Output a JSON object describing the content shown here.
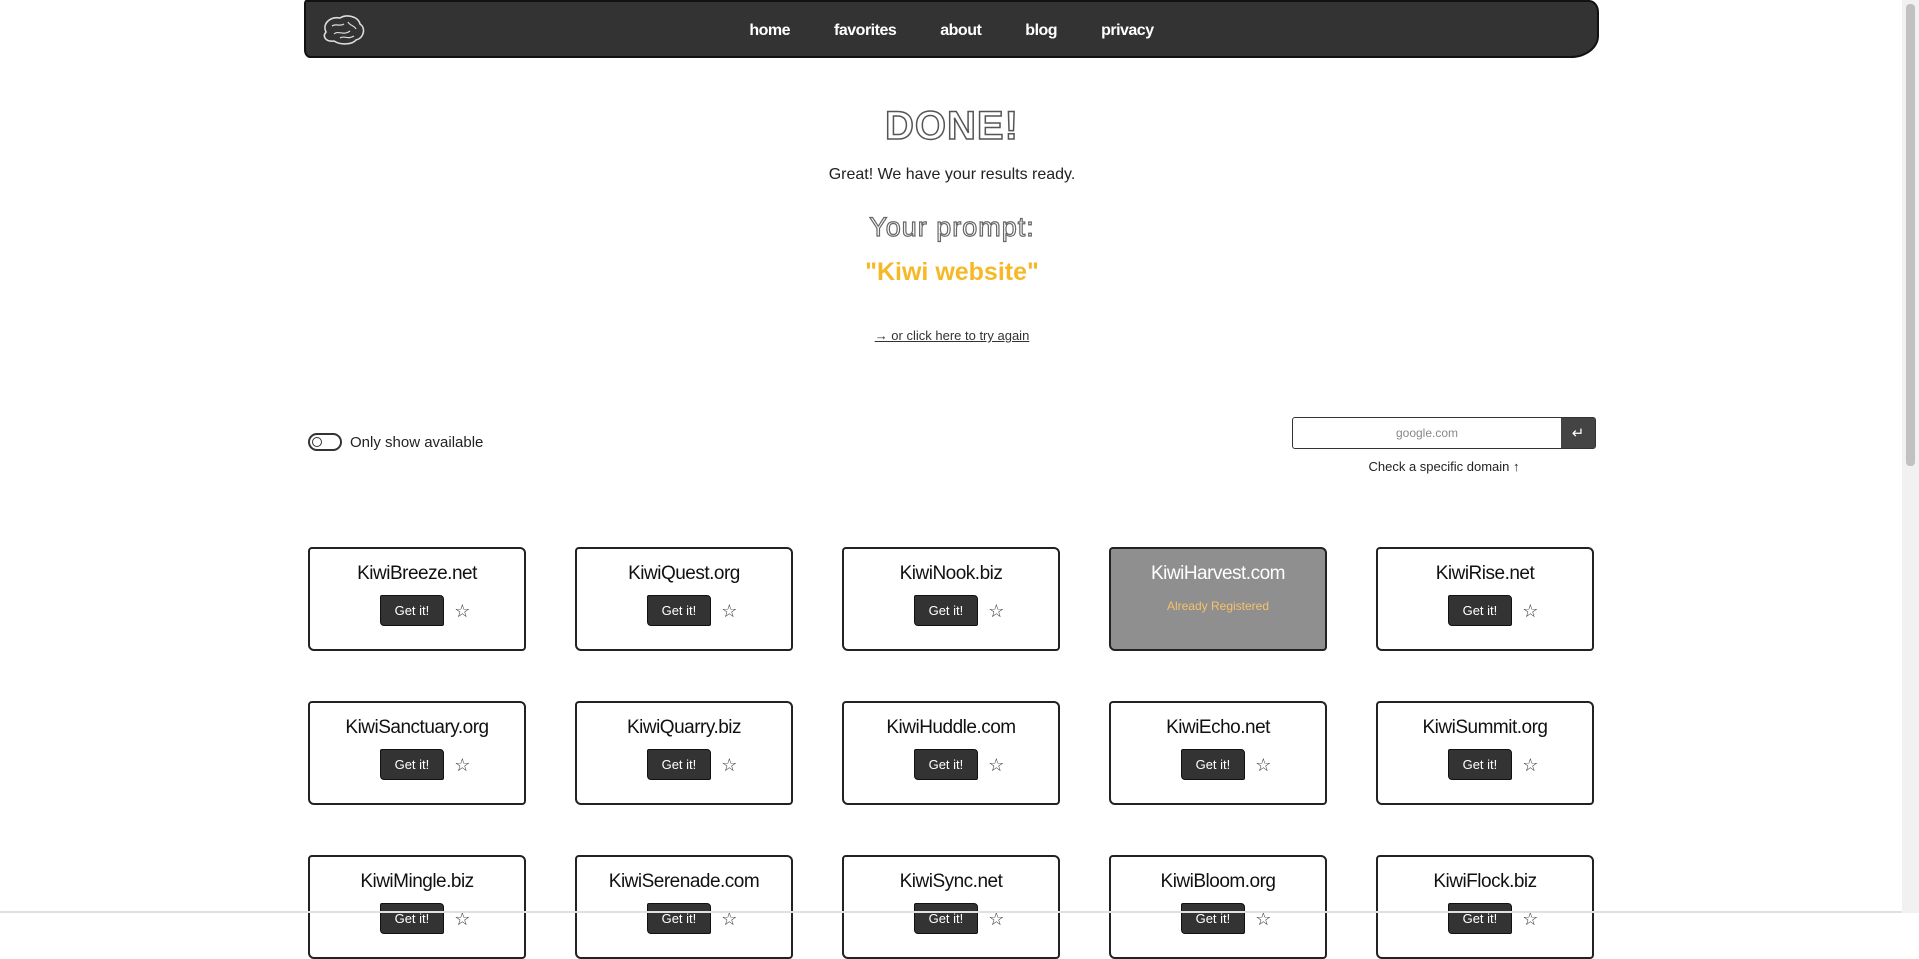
{
  "nav": {
    "links": [
      "home",
      "favorites",
      "about",
      "blog",
      "privacy"
    ]
  },
  "hero": {
    "title": "DONE!",
    "subtitle": "Great! We have your results ready.",
    "prompt_label": "Your prompt:",
    "prompt_value": "\"Kiwi website\"",
    "retry_link": "→ or click here to try again"
  },
  "filters": {
    "toggle_label": "Only show available",
    "toggle_on": false
  },
  "domain_check": {
    "placeholder": "google.com",
    "hint": "Check a specific domain ↑",
    "submit_icon": "↵"
  },
  "results": {
    "get_label": "Get it!",
    "registered_label": "Already Registered",
    "domains": [
      {
        "name": "KiwiBreeze.net",
        "available": true
      },
      {
        "name": "KiwiQuest.org",
        "available": true
      },
      {
        "name": "KiwiNook.biz",
        "available": true
      },
      {
        "name": "KiwiHarvest.com",
        "available": false
      },
      {
        "name": "KiwiRise.net",
        "available": true
      },
      {
        "name": "KiwiSanctuary.org",
        "available": true
      },
      {
        "name": "KiwiQuarry.biz",
        "available": true
      },
      {
        "name": "KiwiHuddle.com",
        "available": true
      },
      {
        "name": "KiwiEcho.net",
        "available": true
      },
      {
        "name": "KiwiSummit.org",
        "available": true
      },
      {
        "name": "KiwiMingle.biz",
        "available": true
      },
      {
        "name": "KiwiSerenade.com",
        "available": true
      },
      {
        "name": "KiwiSync.net",
        "available": true
      },
      {
        "name": "KiwiBloom.org",
        "available": true
      },
      {
        "name": "KiwiFlock.biz",
        "available": true
      }
    ]
  },
  "colors": {
    "navbar": "#333333",
    "accent": "#f5b928",
    "registered_card": "#8f8f8f"
  }
}
